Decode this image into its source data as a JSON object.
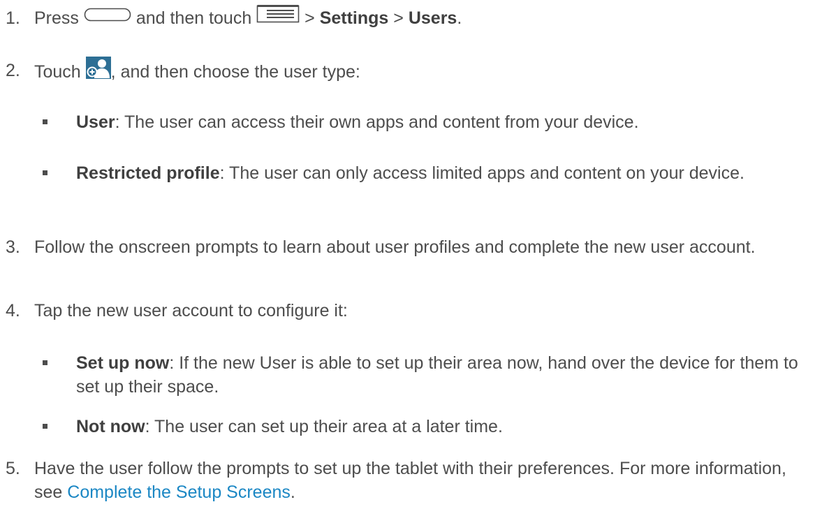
{
  "steps": [
    {
      "num": "1.",
      "a": "Press",
      "b": "and then touch",
      "c": ">",
      "d": "Settings",
      "e": ">",
      "f": "Users",
      "g": "."
    },
    {
      "num": "2.",
      "a": "Touch",
      "b": ", and then choose the user type:"
    },
    {
      "num": "3.",
      "text": "Follow the onscreen prompts to learn about user profiles and complete the new user account."
    },
    {
      "num": "4.",
      "text": "Tap the new user account to configure it:"
    },
    {
      "num": "5.",
      "text": "Have the user follow the prompts to set up the tablet with their preferences. For more information, see",
      "link": "Complete the Setup Screens",
      "end": "."
    }
  ],
  "user_types": [
    {
      "term": "User",
      "desc": ": The user can access their own apps and content from your device."
    },
    {
      "term": "Restricted profile",
      "desc": ": The user can only access limited apps and content on your device."
    }
  ],
  "configure_options": [
    {
      "term": "Set up now",
      "desc": ": If the new User is able to set up their area now, hand over the device for them to set up their space."
    },
    {
      "term": "Not now",
      "desc": ": The user can set up their area at a later time."
    }
  ],
  "icons": {
    "home": "home-button-icon",
    "menu": "menu-icon",
    "add_user": "add-user-icon"
  },
  "colors": {
    "text": "#4d4d4d",
    "link": "#1b87c4",
    "icon_blue": "#2d6f95"
  }
}
